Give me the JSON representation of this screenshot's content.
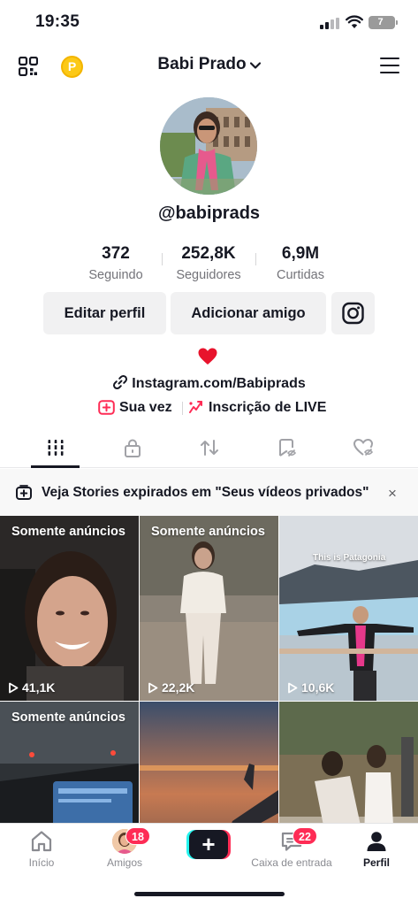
{
  "status_bar": {
    "time": "19:35",
    "battery": "7"
  },
  "header": {
    "coin_letter": "P",
    "profile_name": "Babi Prado"
  },
  "profile": {
    "handle": "@babiprads",
    "stats": [
      {
        "value": "372",
        "label": "Seguindo"
      },
      {
        "value": "252,8K",
        "label": "Seguidores"
      },
      {
        "value": "6,9M",
        "label": "Curtidas"
      }
    ],
    "edit_button": "Editar perfil",
    "add_friend_button": "Adicionar amigo",
    "bio_link": "Instagram.com/Babiprads",
    "pill_1": "Sua vez",
    "pill_2": "Inscrição de LIVE"
  },
  "tabs": [
    "videos-grid",
    "private",
    "reposts",
    "favorites",
    "liked"
  ],
  "banner": {
    "text": "Veja Stories expirados em \"Seus vídeos privados\"",
    "close": "×"
  },
  "videos": [
    {
      "label": "Somente anúncios",
      "views": "41,1K",
      "caption": ""
    },
    {
      "label": "Somente anúncios",
      "views": "22,2K",
      "caption": ""
    },
    {
      "label": "",
      "views": "10,6K",
      "caption": "This is Patagonia"
    },
    {
      "label": "Somente anúncios",
      "views": "",
      "caption": ""
    },
    {
      "label": "",
      "views": "",
      "caption": ""
    },
    {
      "label": "",
      "views": "",
      "caption": ""
    }
  ],
  "bottom_nav": {
    "home": "Início",
    "friends": "Amigos",
    "friends_badge": "18",
    "inbox": "Caixa de entrada",
    "inbox_badge": "22",
    "profile": "Perfil",
    "create": "+"
  },
  "colors": {
    "accent": "#fe2c55",
    "cyan": "#25f4ee",
    "coin": "#fcc917"
  }
}
